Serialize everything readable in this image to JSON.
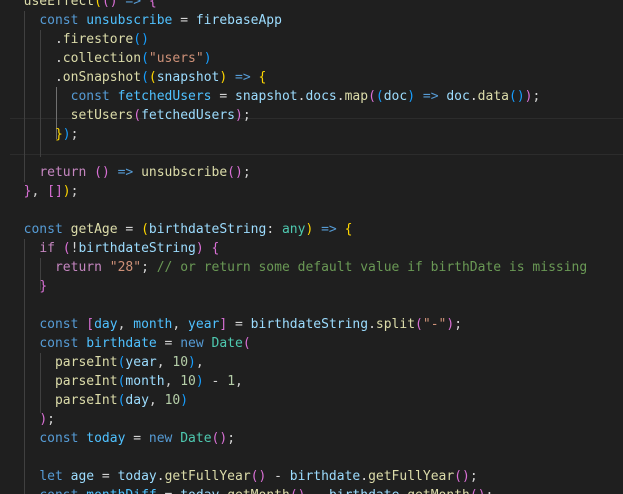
{
  "editor": {
    "colors": {
      "background": "#1f1f1f",
      "keyword": "#569cd6",
      "control": "#c586c0",
      "function": "#dcdcaa",
      "variable": "#9cdcfe",
      "constant": "#4fc1ff",
      "type": "#4ec9b0",
      "string": "#ce9178",
      "number": "#b5cea8",
      "comment": "#6a9955",
      "plain": "#d4d4d4",
      "bracket1": "#ffd700",
      "bracket2": "#da70d6",
      "bracket3": "#179fff"
    },
    "lines": [
      [
        [
          "  ",
          "p"
        ],
        [
          "useEffect",
          "f"
        ],
        [
          "(",
          "b1"
        ],
        [
          "(",
          "b2"
        ],
        [
          ")",
          "b2"
        ],
        [
          " => ",
          "k"
        ],
        [
          "{",
          "b2"
        ]
      ],
      [
        [
          "    ",
          "p"
        ],
        [
          "const ",
          "k"
        ],
        [
          "unsubscribe",
          "c"
        ],
        [
          " = ",
          "p"
        ],
        [
          "firebaseApp",
          "v"
        ]
      ],
      [
        [
          "      .",
          "p"
        ],
        [
          "firestore",
          "f"
        ],
        [
          "(",
          "b3"
        ],
        [
          ")",
          "b3"
        ]
      ],
      [
        [
          "      .",
          "p"
        ],
        [
          "collection",
          "f"
        ],
        [
          "(",
          "b3"
        ],
        [
          "\"users\"",
          "s"
        ],
        [
          ")",
          "b3"
        ]
      ],
      [
        [
          "      .",
          "p"
        ],
        [
          "onSnapshot",
          "f"
        ],
        [
          "(",
          "b3"
        ],
        [
          "(",
          "b1"
        ],
        [
          "snapshot",
          "v"
        ],
        [
          ")",
          "b1"
        ],
        [
          " => ",
          "k"
        ],
        [
          "{",
          "b1"
        ]
      ],
      [
        [
          "        ",
          "p"
        ],
        [
          "const ",
          "k"
        ],
        [
          "fetchedUsers",
          "c"
        ],
        [
          " = ",
          "p"
        ],
        [
          "snapshot",
          "v"
        ],
        [
          ".",
          "p"
        ],
        [
          "docs",
          "v"
        ],
        [
          ".",
          "p"
        ],
        [
          "map",
          "f"
        ],
        [
          "(",
          "b2"
        ],
        [
          "(",
          "b3"
        ],
        [
          "doc",
          "v"
        ],
        [
          ")",
          "b3"
        ],
        [
          " => ",
          "k"
        ],
        [
          "doc",
          "v"
        ],
        [
          ".",
          "p"
        ],
        [
          "data",
          "f"
        ],
        [
          "(",
          "b3"
        ],
        [
          ")",
          "b3"
        ],
        [
          ")",
          "b2"
        ],
        [
          ";",
          "p"
        ]
      ],
      [
        [
          "        ",
          "p"
        ],
        [
          "setUsers",
          "f"
        ],
        [
          "(",
          "b2"
        ],
        [
          "fetchedUsers",
          "v"
        ],
        [
          ")",
          "b2"
        ],
        [
          ";",
          "p"
        ]
      ],
      [
        [
          "      ",
          "p"
        ],
        [
          "}",
          "b1"
        ],
        [
          ")",
          "b3"
        ],
        [
          ";",
          "p"
        ]
      ],
      [
        [
          "",
          "p"
        ]
      ],
      [
        [
          "    ",
          "p"
        ],
        [
          "return ",
          "ctl"
        ],
        [
          "(",
          "b2"
        ],
        [
          ")",
          "b2"
        ],
        [
          " => ",
          "k"
        ],
        [
          "unsubscribe",
          "f"
        ],
        [
          "(",
          "b2"
        ],
        [
          ")",
          "b2"
        ],
        [
          ";",
          "p"
        ]
      ],
      [
        [
          "  ",
          "p"
        ],
        [
          "}",
          "b2"
        ],
        [
          ", ",
          "p"
        ],
        [
          "[",
          "b2"
        ],
        [
          "]",
          "b2"
        ],
        [
          ")",
          "b1"
        ],
        [
          ";",
          "p"
        ]
      ],
      [
        [
          "",
          "p"
        ]
      ],
      [
        [
          "  ",
          "p"
        ],
        [
          "const ",
          "k"
        ],
        [
          "getAge",
          "f"
        ],
        [
          " = ",
          "p"
        ],
        [
          "(",
          "b1"
        ],
        [
          "birthdateString",
          "v"
        ],
        [
          ": ",
          "p"
        ],
        [
          "any",
          "t"
        ],
        [
          ")",
          "b1"
        ],
        [
          " => ",
          "k"
        ],
        [
          "{",
          "b1"
        ]
      ],
      [
        [
          "    ",
          "p"
        ],
        [
          "if ",
          "ctl"
        ],
        [
          "(",
          "b2"
        ],
        [
          "!",
          "p"
        ],
        [
          "birthdateString",
          "v"
        ],
        [
          ")",
          "b2"
        ],
        [
          " ",
          "p"
        ],
        [
          "{",
          "b2"
        ]
      ],
      [
        [
          "      ",
          "p"
        ],
        [
          "return ",
          "ctl"
        ],
        [
          "\"28\"",
          "s"
        ],
        [
          "; ",
          "p"
        ],
        [
          "// or return some default value if birthDate is missing",
          "cm"
        ]
      ],
      [
        [
          "    ",
          "p"
        ],
        [
          "}",
          "b2"
        ]
      ],
      [
        [
          "",
          "p"
        ]
      ],
      [
        [
          "    ",
          "p"
        ],
        [
          "const ",
          "k"
        ],
        [
          "[",
          "b2"
        ],
        [
          "day",
          "c"
        ],
        [
          ", ",
          "p"
        ],
        [
          "month",
          "c"
        ],
        [
          ", ",
          "p"
        ],
        [
          "year",
          "c"
        ],
        [
          "]",
          "b2"
        ],
        [
          " = ",
          "p"
        ],
        [
          "birthdateString",
          "v"
        ],
        [
          ".",
          "p"
        ],
        [
          "split",
          "f"
        ],
        [
          "(",
          "b2"
        ],
        [
          "\"-\"",
          "s"
        ],
        [
          ")",
          "b2"
        ],
        [
          ";",
          "p"
        ]
      ],
      [
        [
          "    ",
          "p"
        ],
        [
          "const ",
          "k"
        ],
        [
          "birthdate",
          "c"
        ],
        [
          " = ",
          "p"
        ],
        [
          "new ",
          "k"
        ],
        [
          "Date",
          "t"
        ],
        [
          "(",
          "b2"
        ]
      ],
      [
        [
          "      ",
          "p"
        ],
        [
          "parseInt",
          "f"
        ],
        [
          "(",
          "b3"
        ],
        [
          "year",
          "v"
        ],
        [
          ", ",
          "p"
        ],
        [
          "10",
          "n"
        ],
        [
          ")",
          "b3"
        ],
        [
          ",",
          "p"
        ]
      ],
      [
        [
          "      ",
          "p"
        ],
        [
          "parseInt",
          "f"
        ],
        [
          "(",
          "b3"
        ],
        [
          "month",
          "v"
        ],
        [
          ", ",
          "p"
        ],
        [
          "10",
          "n"
        ],
        [
          ")",
          "b3"
        ],
        [
          " - ",
          "p"
        ],
        [
          "1",
          "n"
        ],
        [
          ",",
          "p"
        ]
      ],
      [
        [
          "      ",
          "p"
        ],
        [
          "parseInt",
          "f"
        ],
        [
          "(",
          "b3"
        ],
        [
          "day",
          "v"
        ],
        [
          ", ",
          "p"
        ],
        [
          "10",
          "n"
        ],
        [
          ")",
          "b3"
        ]
      ],
      [
        [
          "    ",
          "p"
        ],
        [
          ")",
          "b2"
        ],
        [
          ";",
          "p"
        ]
      ],
      [
        [
          "    ",
          "p"
        ],
        [
          "const ",
          "k"
        ],
        [
          "today",
          "c"
        ],
        [
          " = ",
          "p"
        ],
        [
          "new ",
          "k"
        ],
        [
          "Date",
          "t"
        ],
        [
          "(",
          "b2"
        ],
        [
          ")",
          "b2"
        ],
        [
          ";",
          "p"
        ]
      ],
      [
        [
          "",
          "p"
        ]
      ],
      [
        [
          "    ",
          "p"
        ],
        [
          "let ",
          "k"
        ],
        [
          "age",
          "v"
        ],
        [
          " = ",
          "p"
        ],
        [
          "today",
          "v"
        ],
        [
          ".",
          "p"
        ],
        [
          "getFullYear",
          "f"
        ],
        [
          "(",
          "b2"
        ],
        [
          ")",
          "b2"
        ],
        [
          " - ",
          "p"
        ],
        [
          "birthdate",
          "v"
        ],
        [
          ".",
          "p"
        ],
        [
          "getFullYear",
          "f"
        ],
        [
          "(",
          "b2"
        ],
        [
          ")",
          "b2"
        ],
        [
          ";",
          "p"
        ]
      ],
      [
        [
          "    ",
          "p"
        ],
        [
          "const ",
          "k"
        ],
        [
          "monthDiff",
          "c"
        ],
        [
          " = ",
          "p"
        ],
        [
          "today",
          "v"
        ],
        [
          ".",
          "p"
        ],
        [
          "getMonth",
          "f"
        ],
        [
          "(",
          "b2"
        ],
        [
          ")",
          "b2"
        ],
        [
          " - ",
          "p"
        ],
        [
          "birthdate",
          "v"
        ],
        [
          ".",
          "p"
        ],
        [
          "getMonth",
          "f"
        ],
        [
          "(",
          "b2"
        ],
        [
          ")",
          "b2"
        ],
        [
          ";",
          "p"
        ]
      ]
    ]
  }
}
